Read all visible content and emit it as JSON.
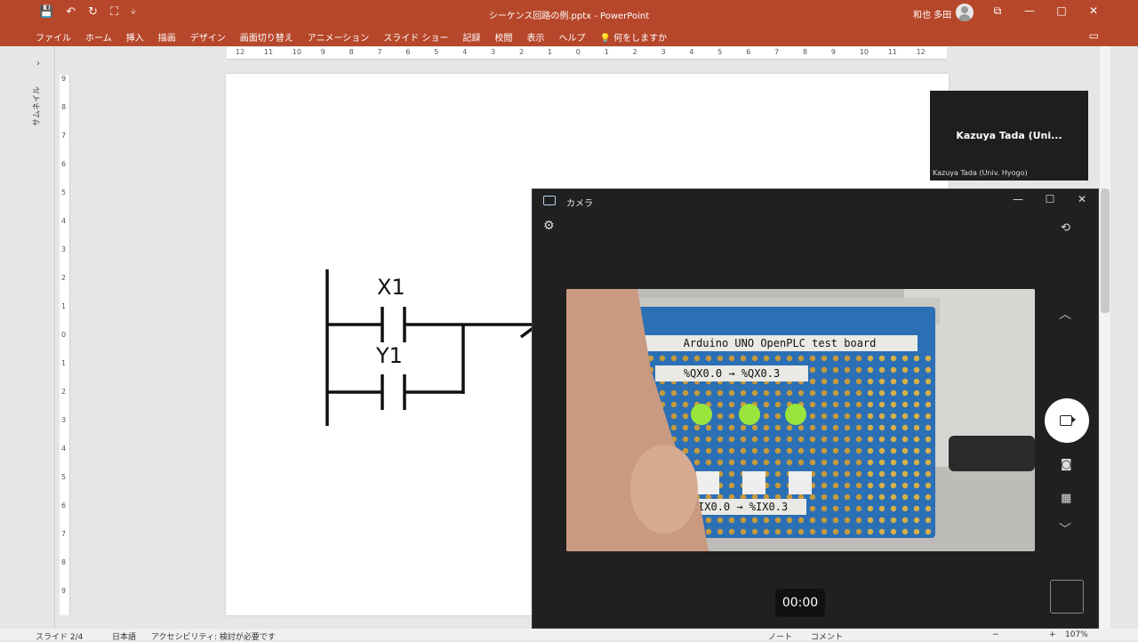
{
  "window": {
    "title": "シーケンス回路の例.pptx  -  PowerPoint",
    "user": "和也 多田",
    "controls": {
      "restore_ribbon": "⧉",
      "minimize": "—",
      "maximize": "□",
      "close": "✕"
    }
  },
  "qat": {
    "save": "💾",
    "undo": "↶",
    "redo": "↻",
    "present": "⛶",
    "more": "⩒"
  },
  "ribbon": {
    "tabs": [
      "ファイル",
      "ホーム",
      "挿入",
      "描画",
      "デザイン",
      "画面切り替え",
      "アニメーション",
      "スライド ショー",
      "記録",
      "校閲",
      "表示",
      "ヘルプ"
    ],
    "search": "何をしますか",
    "comment_icon": "▭"
  },
  "left_pane": {
    "label": "サムネイル",
    "expand": "›"
  },
  "hruler": {
    "ticks": [
      "12",
      "11",
      "10",
      "9",
      "8",
      "7",
      "6",
      "5",
      "4",
      "3",
      "2",
      "1",
      "0",
      "1",
      "2",
      "3",
      "4",
      "5",
      "6",
      "7",
      "8",
      "9",
      "10",
      "11",
      "12"
    ]
  },
  "vruler": {
    "ticks": [
      "9",
      "8",
      "7",
      "6",
      "5",
      "4",
      "3",
      "2",
      "1",
      "0",
      "1",
      "2",
      "3",
      "4",
      "5",
      "6",
      "7",
      "8",
      "9"
    ]
  },
  "slide": {
    "contact1": "X1",
    "contact2": "Y1"
  },
  "video_tile": {
    "name": "Kazuya Tada (Uni...",
    "full_name": "Kazuya Tada (Univ. Hyogo)"
  },
  "camera": {
    "title": "カメラ",
    "minimize": "—",
    "maximize": "☐",
    "close": "✕",
    "settings": "⚙",
    "switch": "⟲",
    "up": "︿",
    "down": "﹀",
    "photo": "◙",
    "qr": "▦",
    "timer": "00:00",
    "preview": {
      "board_label": "Arduino UNO OpenPLC test board",
      "output_label": "%QX0.0 → %QX0.3",
      "input_label": "%IX0.0 → %IX0.3",
      "led_color": "#9be43c",
      "pcb_color": "#2b6fb5"
    }
  },
  "status": {
    "slide": "スライド 2/4",
    "language": "日本語",
    "accessibility": "アクセシビリティ: 検討が必要です",
    "notes": "ノート",
    "comments": "コメント",
    "zoom_minus": "−",
    "zoom_plus": "+",
    "zoom": "107%"
  }
}
